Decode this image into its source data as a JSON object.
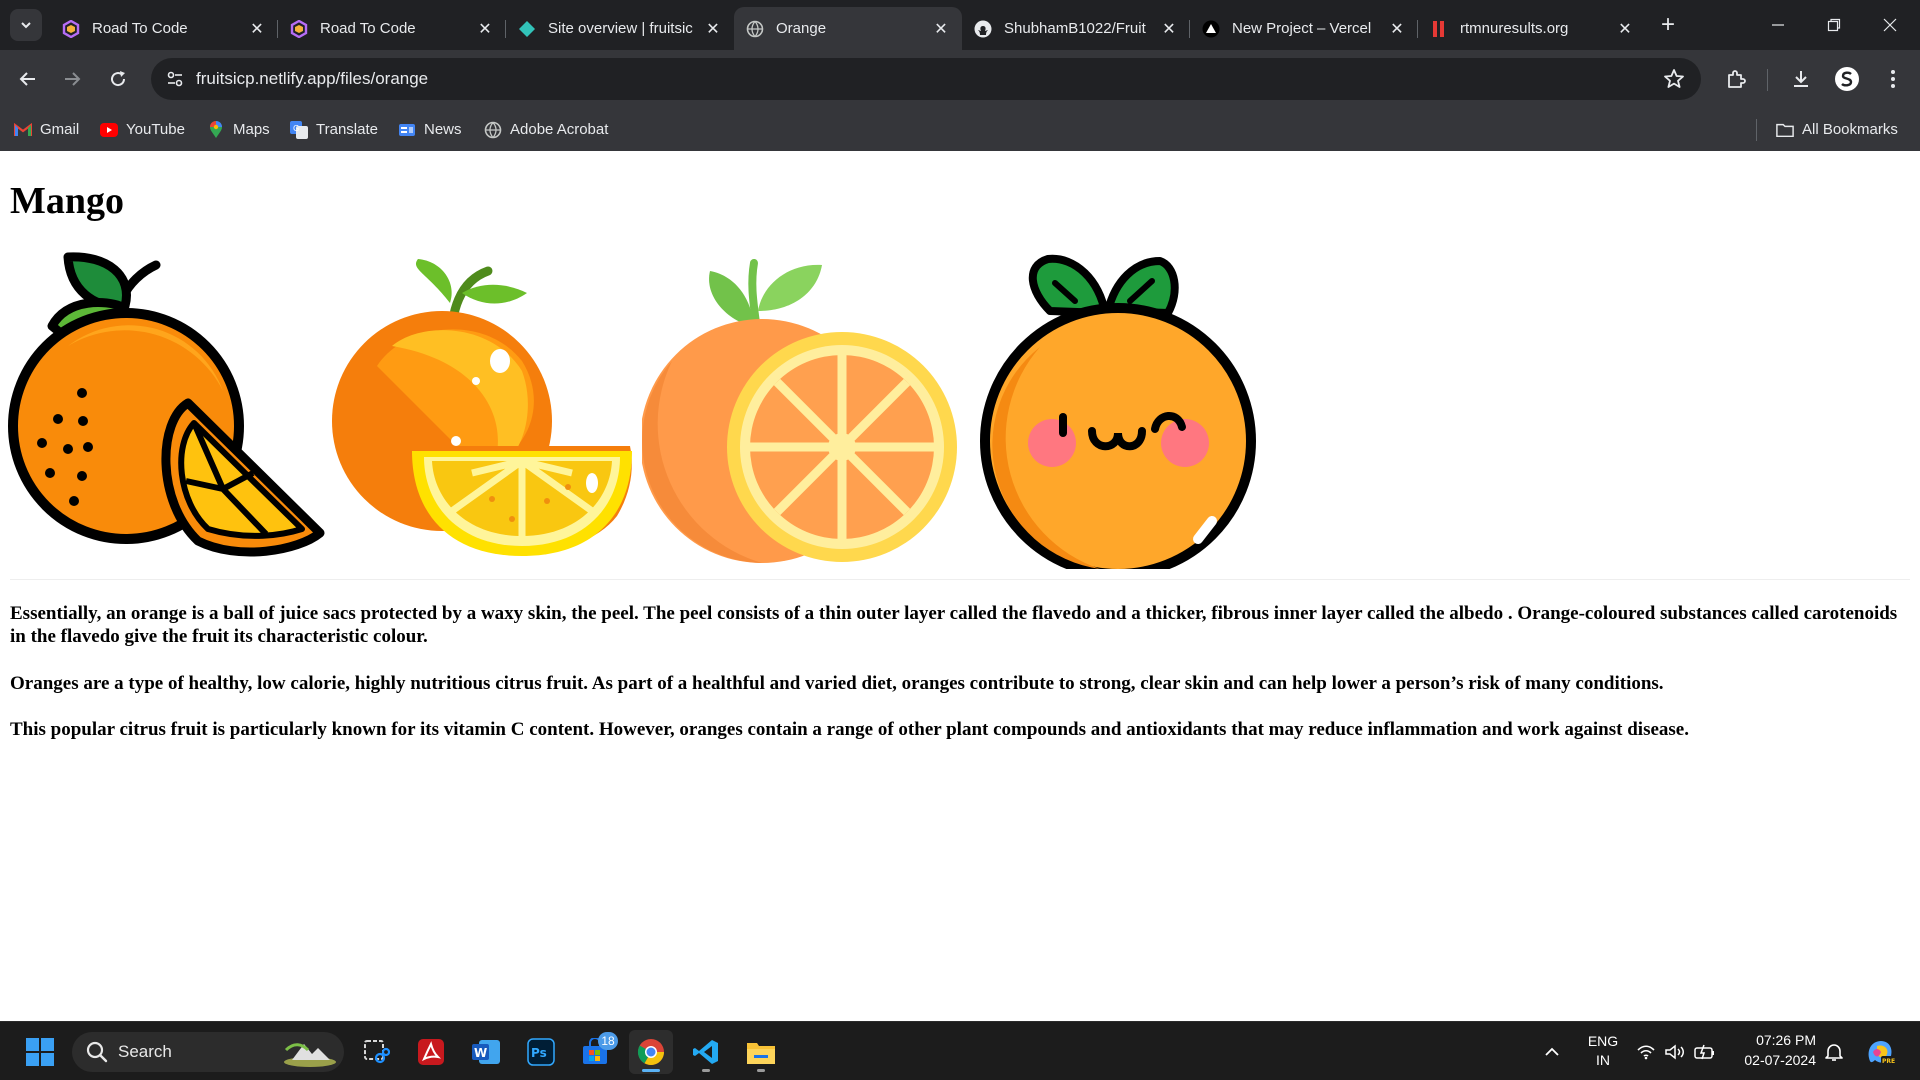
{
  "tabs": [
    {
      "title": "Road To Code",
      "favicon": "hexagon-icon",
      "active": false
    },
    {
      "title": "Road To Code",
      "favicon": "hexagon-icon",
      "active": false
    },
    {
      "title": "Site overview | fruitsic",
      "favicon": "netlify-icon",
      "active": false
    },
    {
      "title": "Orange",
      "favicon": "globe-icon",
      "active": true
    },
    {
      "title": "ShubhamB1022/Fruit",
      "favicon": "github-icon",
      "active": false
    },
    {
      "title": "New Project – Vercel",
      "favicon": "vercel-icon",
      "active": false
    },
    {
      "title": "rtmnuresults.org",
      "favicon": "rtmnu-icon",
      "active": false
    }
  ],
  "address": {
    "url": "fruitsicp.netlify.app/files/orange"
  },
  "bookmarks": [
    {
      "label": "Gmail",
      "icon": "gmail-icon"
    },
    {
      "label": "YouTube",
      "icon": "youtube-icon"
    },
    {
      "label": "Maps",
      "icon": "maps-icon"
    },
    {
      "label": "Translate",
      "icon": "translate-icon"
    },
    {
      "label": "News",
      "icon": "news-icon"
    },
    {
      "label": "Adobe Acrobat",
      "icon": "globe-icon"
    }
  ],
  "all_bookmarks": "All Bookmarks",
  "page": {
    "heading": "Mango",
    "paragraphs": [
      "Essentially, an orange is a ball of juice sacs protected by a waxy skin, the peel. The peel consists of a thin outer layer called the flavedo and a thicker, fibrous inner layer called the albedo . Orange-coloured substances called carotenoids in the flavedo give the fruit its characteristic colour.",
      "Oranges are a type of healthy, low calorie, highly nutritious citrus fruit. As part of a healthful and varied diet, oranges contribute to strong, clear skin and can help lower a person’s risk of many conditions.",
      "This popular citrus fruit is particularly known for its vitamin C content. However, oranges contain a range of other plant compounds and antioxidants that may reduce inflammation and work against disease."
    ]
  },
  "taskbar": {
    "search_label": "Search",
    "badge": "18",
    "lang_line1": "ENG",
    "lang_line2": "IN",
    "time": "07:26 PM",
    "date": "02-07-2024"
  },
  "colors": {
    "accent": "#8ab4f8",
    "orange": "#ff9800",
    "background": "#202124"
  }
}
